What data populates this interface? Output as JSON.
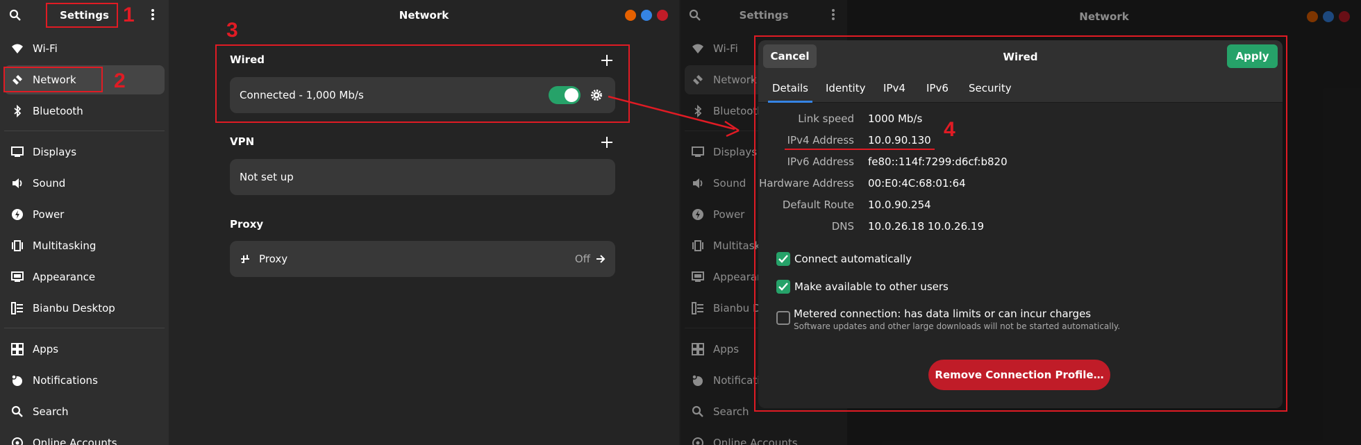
{
  "left": {
    "sidebar": {
      "title": "Settings",
      "items": [
        {
          "label": "Wi-Fi",
          "icon": "wifi-icon"
        },
        {
          "label": "Network",
          "icon": "network-icon"
        },
        {
          "label": "Bluetooth",
          "icon": "bluetooth-icon"
        },
        {
          "label": "Displays",
          "icon": "display-icon"
        },
        {
          "label": "Sound",
          "icon": "sound-icon"
        },
        {
          "label": "Power",
          "icon": "power-icon"
        },
        {
          "label": "Multitasking",
          "icon": "multitasking-icon"
        },
        {
          "label": "Appearance",
          "icon": "appearance-icon"
        },
        {
          "label": "Bianbu Desktop",
          "icon": "desktop-icon"
        },
        {
          "label": "Apps",
          "icon": "apps-icon"
        },
        {
          "label": "Notifications",
          "icon": "bell-icon"
        },
        {
          "label": "Search",
          "icon": "search-icon"
        },
        {
          "label": "Online Accounts",
          "icon": "accounts-icon"
        }
      ]
    },
    "main": {
      "title": "Network",
      "wired_label": "Wired",
      "wired_status": "Connected - 1,000 Mb/s",
      "vpn_label": "VPN",
      "vpn_status": "Not set up",
      "proxy_label": "Proxy",
      "proxy_row": "Proxy",
      "proxy_value": "Off"
    }
  },
  "right": {
    "sidebar": {
      "title": "Settings",
      "items": [
        "Wi-Fi",
        "Network",
        "Bluetooth",
        "Displays",
        "Sound",
        "Power",
        "Multitaski",
        "Appearanc",
        "Bianbu De",
        "Apps",
        "Notificatio",
        "Search",
        "Online Accounts"
      ]
    },
    "main": {
      "title": "Network"
    },
    "dialog": {
      "cancel": "Cancel",
      "title": "Wired",
      "apply": "Apply",
      "tabs": [
        "Details",
        "Identity",
        "IPv4",
        "IPv6",
        "Security"
      ],
      "details": [
        {
          "label": "Link speed",
          "value": "1000 Mb/s"
        },
        {
          "label": "IPv4 Address",
          "value": "10.0.90.130"
        },
        {
          "label": "IPv6 Address",
          "value": "fe80::114f:7299:d6cf:b820"
        },
        {
          "label": "Hardware Address",
          "value": "00:E0:4C:68:01:64"
        },
        {
          "label": "Default Route",
          "value": "10.0.90.254"
        },
        {
          "label": "DNS",
          "value": "10.0.26.18 10.0.26.19"
        }
      ],
      "connect_auto": "Connect automatically",
      "available_others": "Make available to other users",
      "metered": "Metered connection: has data limits or can incur charges",
      "metered_sub": "Software updates and other large downloads will not be started automatically.",
      "remove": "Remove Connection Profile…"
    }
  },
  "annotations": [
    "1",
    "2",
    "3",
    "4"
  ],
  "colors": {
    "accent": "#26a269",
    "destructive": "#c01c28",
    "annotation": "#e01b24",
    "tab_underline": "#3584e4"
  }
}
